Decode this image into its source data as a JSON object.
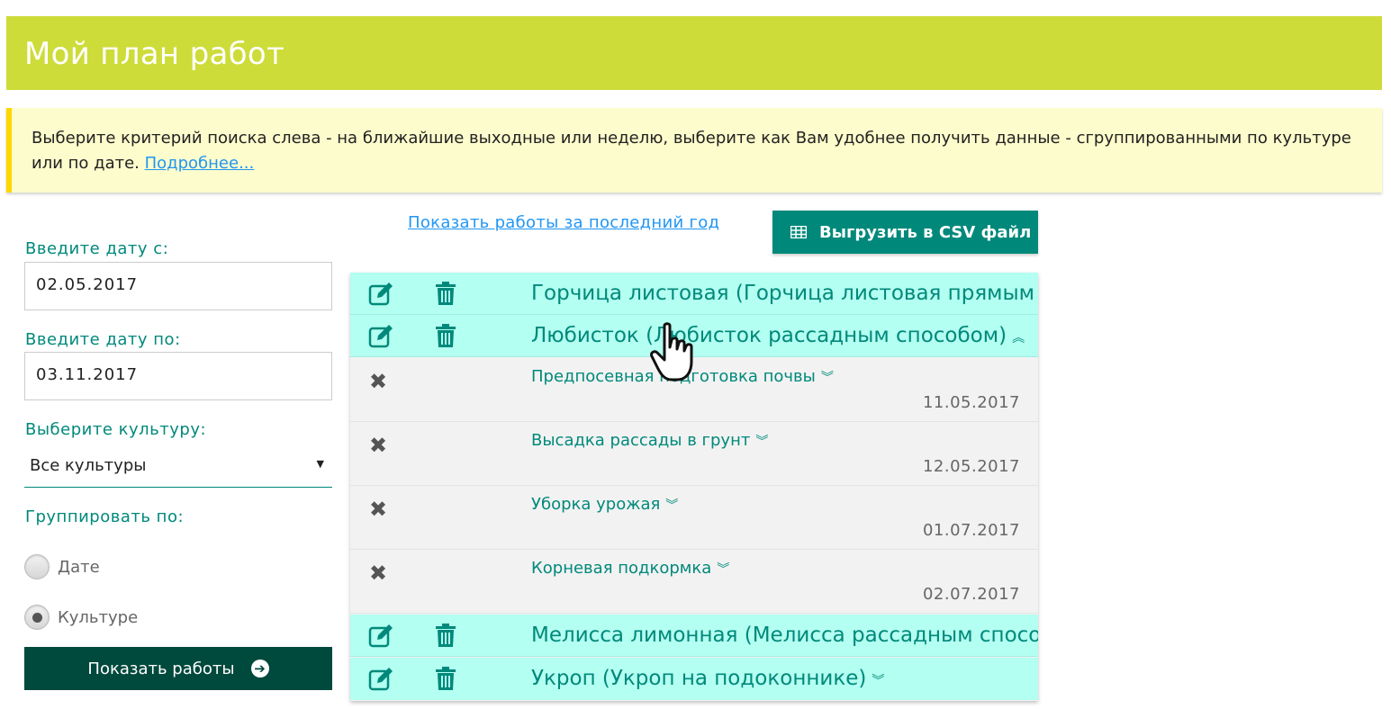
{
  "header": {
    "title": "Мой план работ"
  },
  "notice": {
    "text": "Выберите критерий поиска слева - на ближайшие выходные или неделю, выберите как Вам удобнее получить данные - сгруппированными по культуре или по дате.",
    "link": "Подробнее..."
  },
  "filters": {
    "date_from_label": "Введите дату с:",
    "date_from_value": "02.05.2017",
    "date_to_label": "Введите дату по:",
    "date_to_value": "03.11.2017",
    "crop_label": "Выберите культуру:",
    "crop_value": "Все культуры",
    "group_label": "Группировать по:",
    "group_options": [
      {
        "label": "Дате",
        "checked": false
      },
      {
        "label": "Культуре",
        "checked": true
      }
    ],
    "show_button": "Показать работы"
  },
  "actions": {
    "last_year_link": "Показать работы за последний год",
    "csv_button": "Выгрузить в CSV файл"
  },
  "crops": [
    {
      "name": "Горчица листовая (Горчица листовая прямым посевом)",
      "expanded": false
    },
    {
      "name": "Любисток (Любисток рассадным способом)",
      "expanded": true
    },
    {
      "name": "Мелисса лимонная (Мелисса рассадным способом)",
      "expanded": false
    },
    {
      "name": "Укроп (Укроп на подоконнике)",
      "expanded": false
    }
  ],
  "works": [
    {
      "name": "Предпосевная подготовка почвы",
      "date": "11.05.2017"
    },
    {
      "name": "Высадка рассады в грунт",
      "date": "12.05.2017"
    },
    {
      "name": "Уборка урожая",
      "date": "01.07.2017"
    },
    {
      "name": "Корневая подкормка",
      "date": "02.07.2017"
    }
  ],
  "colors": {
    "header_bg": "#cddc39",
    "accent": "#00897b",
    "row_bg": "#b3fff1",
    "dark_button": "#00493d",
    "link": "#2196f3"
  }
}
